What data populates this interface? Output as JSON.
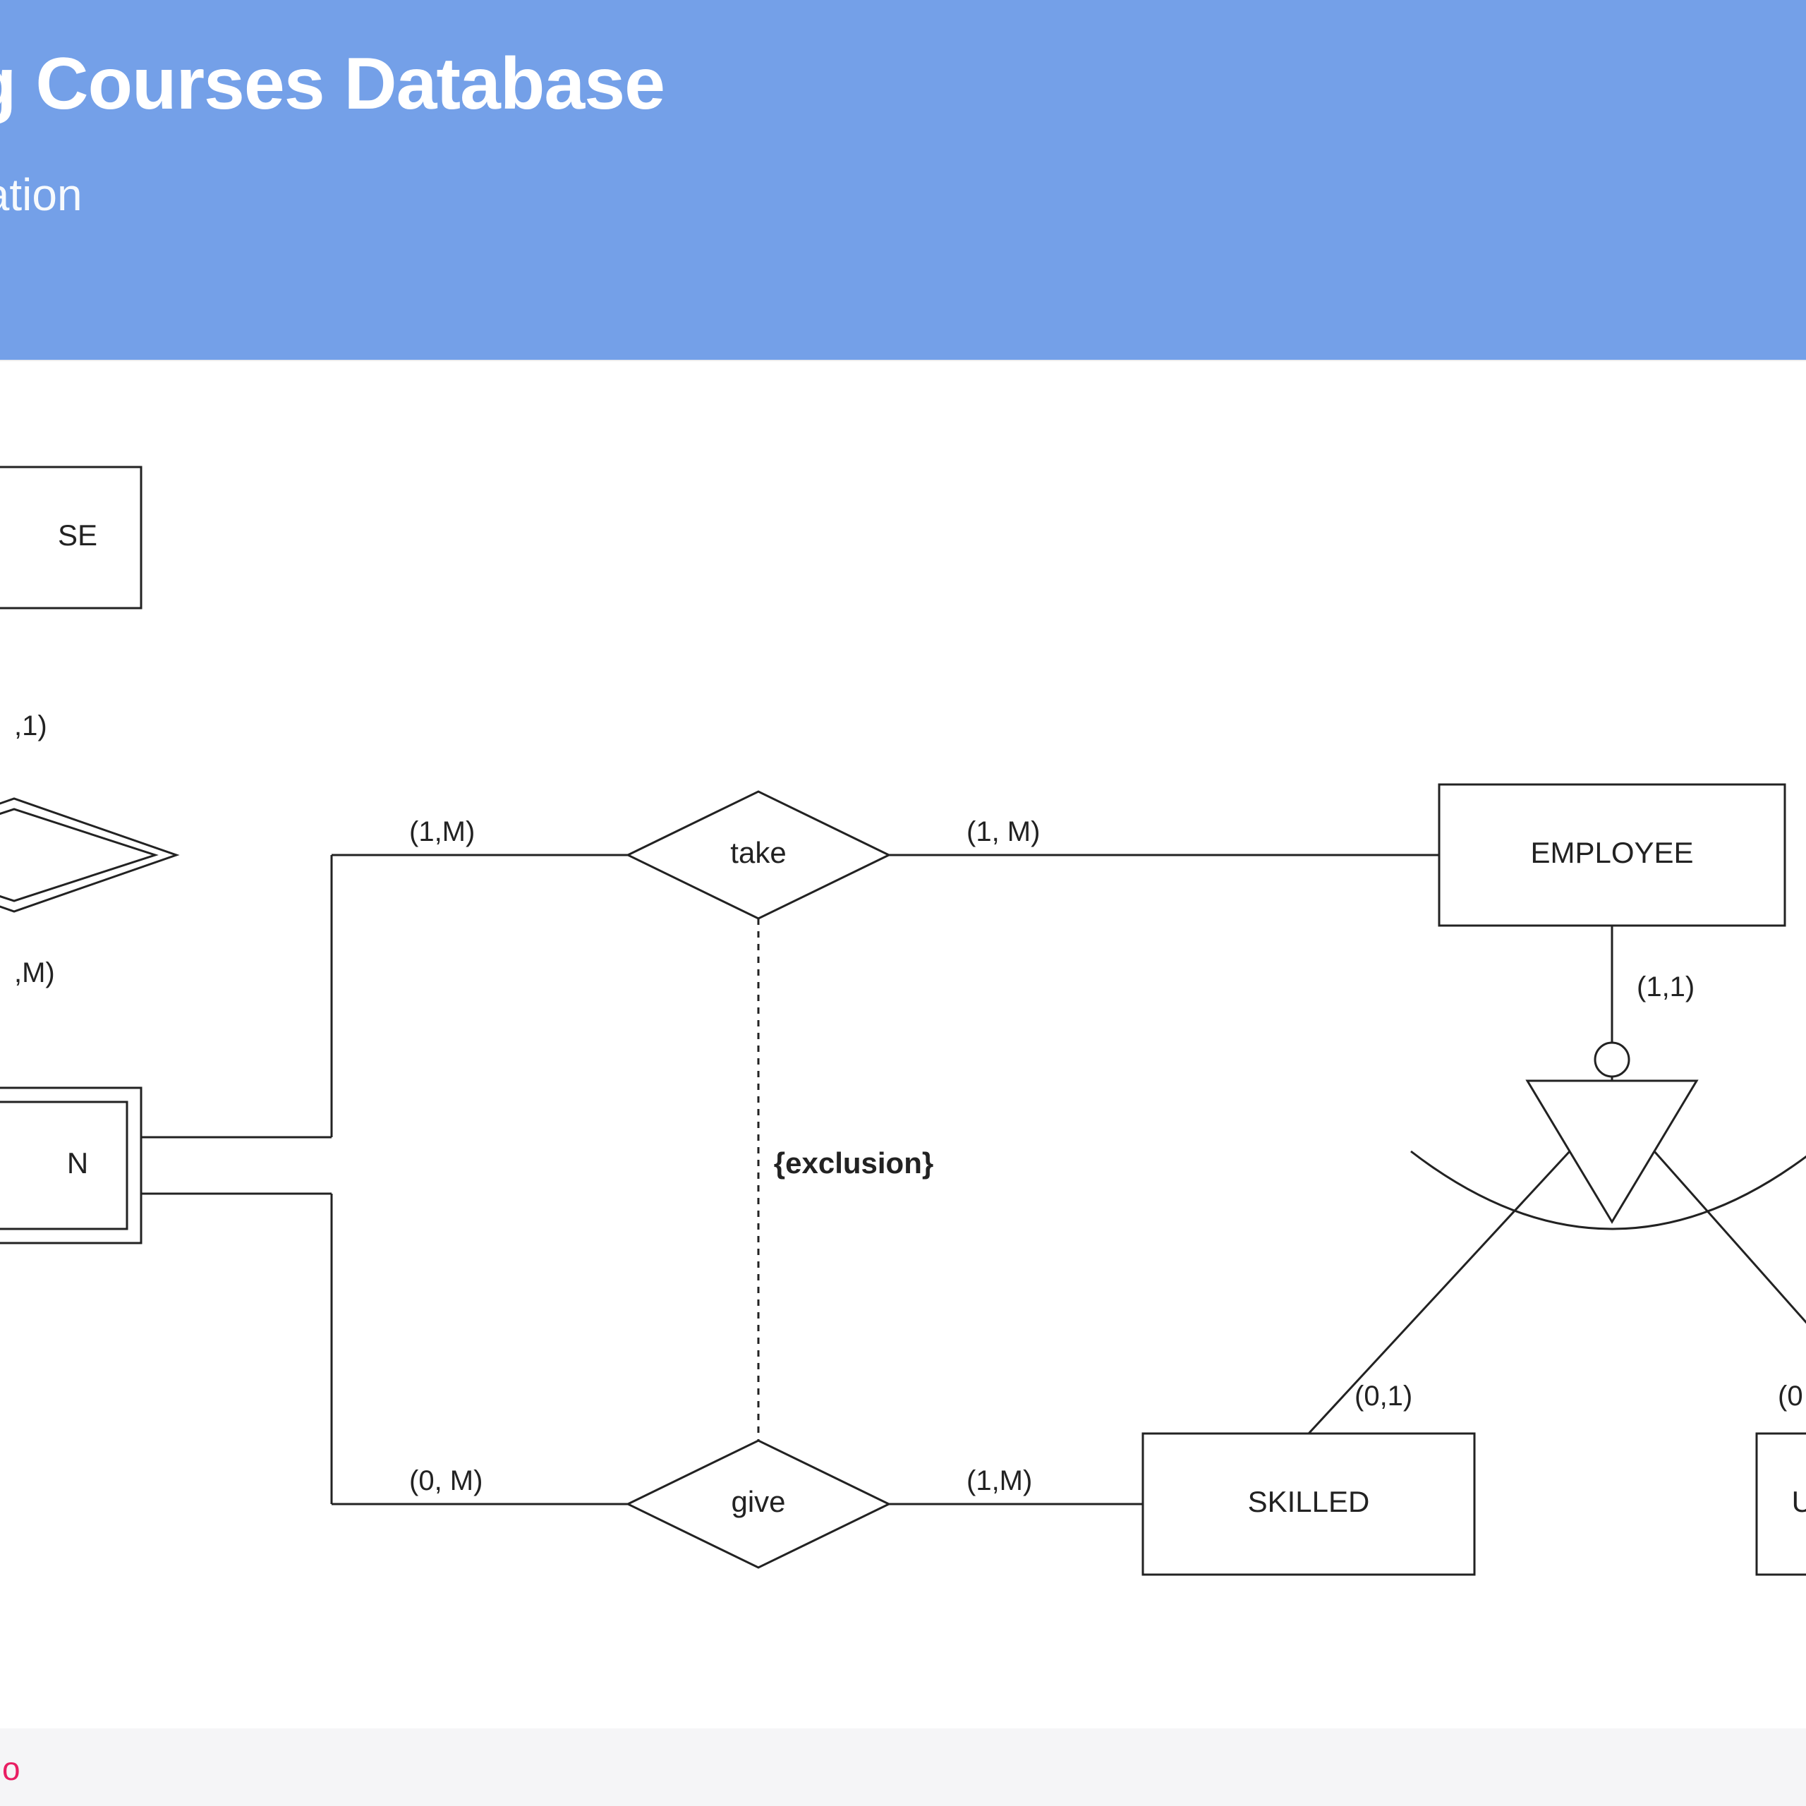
{
  "header": {
    "title_fragment": "g Courses Database",
    "subtitle_fragment": "tation"
  },
  "entities": {
    "course_fragment": "SE",
    "edition_fragment": "N",
    "employee": "EMPLOYEE",
    "skilled": "SKILLED",
    "unskilled_fragment": "UN"
  },
  "relationships": {
    "take": "take",
    "give": "give",
    "exclusion": "{exclusion}"
  },
  "cardinalities": {
    "top_left_1": ",1)",
    "top_left_2": ",M)",
    "take_left": "(1,M)",
    "take_right": "(1, M)",
    "give_left": "(0, M)",
    "give_right": "(1,M)",
    "emp_isa": "(1,1)",
    "skilled_card": "(0,1)",
    "unskilled_card": "(0"
  },
  "footer": {
    "text_fragment": ".io"
  }
}
